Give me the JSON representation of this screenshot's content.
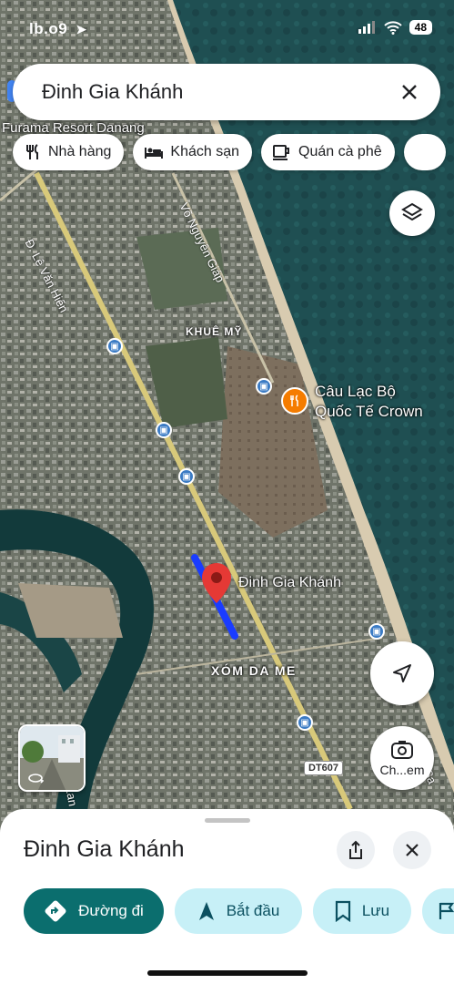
{
  "status": {
    "time": "lb.o9",
    "battery": "48"
  },
  "search": {
    "query": "Đinh Gia Khánh"
  },
  "chips": [
    {
      "label": "Nhà hàng",
      "icon": "restaurant-icon"
    },
    {
      "label": "Khách sạn",
      "icon": "hotel-icon"
    },
    {
      "label": "Quán cà phê",
      "icon": "coffee-icon"
    }
  ],
  "map_labels": {
    "resort": "Furama Resort Danang",
    "road_levanhien": "Đ. Lê Văn Hiến",
    "road_vonguyengiap": "Võ Nguyên Giáp",
    "khue_my": "KHUÊ MỸ",
    "crown_line1": "Câu Lạc Bộ",
    "crown_line2": "Quốc Tế Crown",
    "pin": "Đinh Gia Khánh",
    "xom_da_me": "XÓM DA ME",
    "dt_shield": "DT607",
    "road_bottom_left": "Lan",
    "road_bottom_right": "Sa"
  },
  "lens_label": "Ch...em",
  "sheet": {
    "title": "Đinh Gia Khánh",
    "actions": {
      "directions": "Đường đi",
      "start": "Bắt đầu",
      "save": "Lưu"
    }
  },
  "colors": {
    "primary": "#0b6e6e",
    "secondary": "#c7f0f7",
    "route": "#1a3cff",
    "pin": "#e53935"
  }
}
